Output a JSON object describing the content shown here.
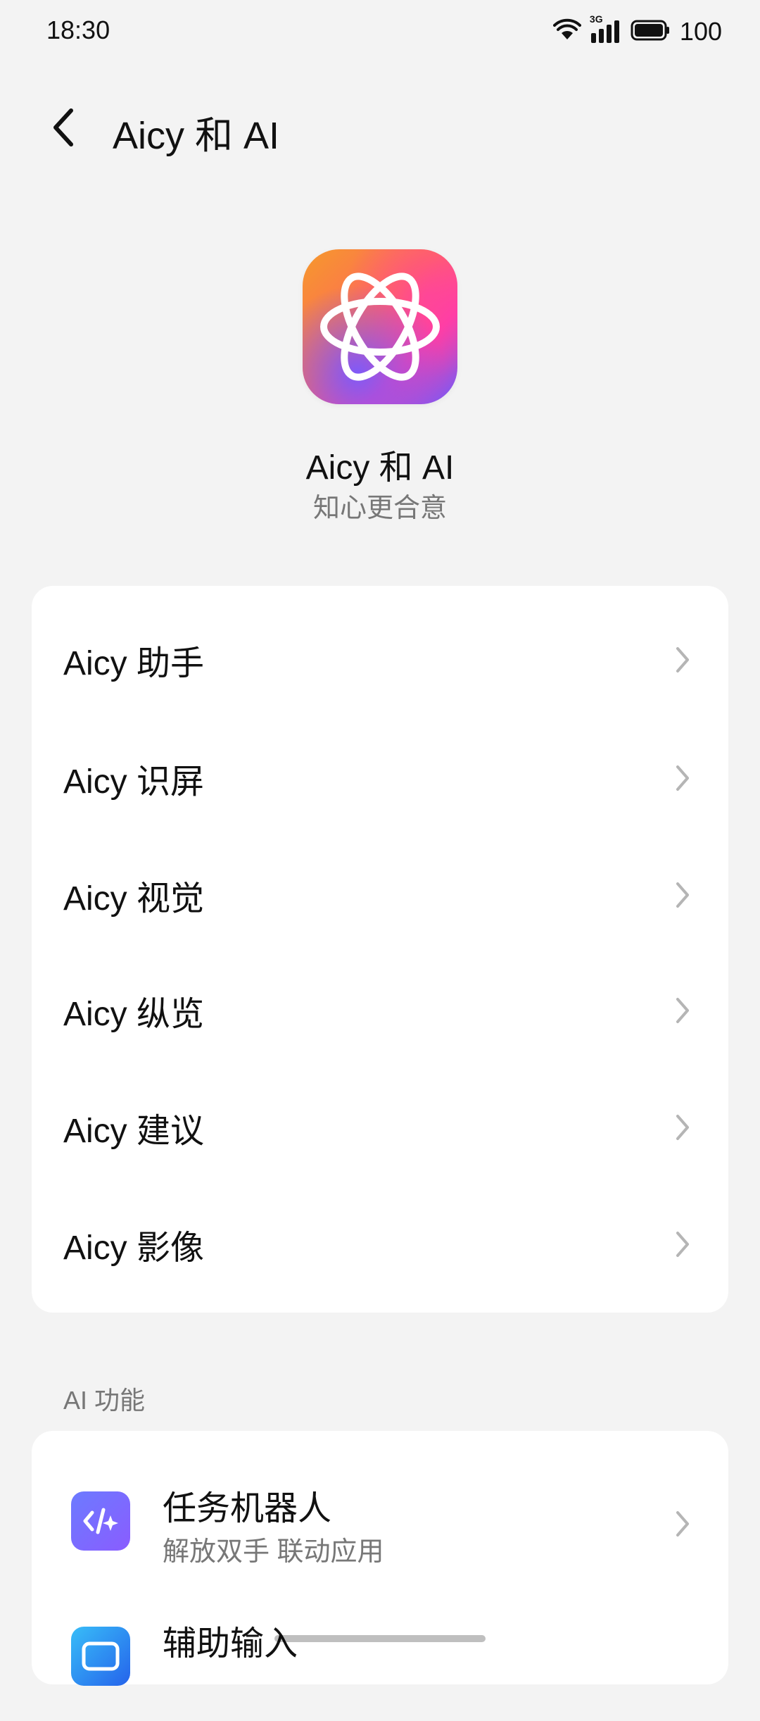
{
  "status_bar": {
    "time": "18:30",
    "battery": "100",
    "network_label": "3G",
    "icons": [
      "wifi-icon",
      "signal-icon",
      "battery-icon"
    ]
  },
  "header": {
    "title": "Aicy 和 AI",
    "back_icon": "chevron-left-icon"
  },
  "app": {
    "name": "Aicy 和 AI",
    "subtitle": "知心更合意",
    "icon": "aicy-logo-icon"
  },
  "menu": {
    "items": [
      {
        "label": "Aicy 助手"
      },
      {
        "label": "Aicy 识屏"
      },
      {
        "label": "Aicy 视觉"
      },
      {
        "label": "Aicy 纵览"
      },
      {
        "label": "Aicy 建议"
      },
      {
        "label": "Aicy 影像"
      }
    ]
  },
  "ai_features": {
    "section_title": "AI 功能",
    "items": [
      {
        "title": "任务机器人",
        "subtitle": "解放双手 联动应用",
        "icon": "task-robot-icon"
      },
      {
        "title": "辅助输入",
        "icon": "input-assist-icon"
      }
    ]
  },
  "colors": {
    "background": "#f3f3f3",
    "card": "#ffffff",
    "text_primary": "#111111",
    "text_secondary": "#777777"
  }
}
